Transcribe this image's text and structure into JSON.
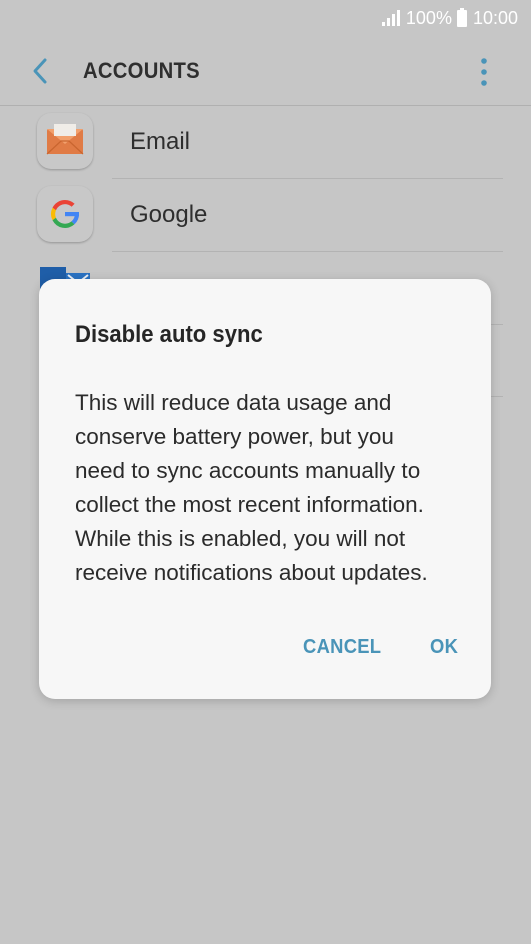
{
  "status_bar": {
    "battery_percent": "100%",
    "time": "10:00"
  },
  "app_bar": {
    "title": "ACCOUNTS",
    "back_icon": "chevron-left-icon",
    "more_icon": "more-vert-icon"
  },
  "accounts": [
    {
      "label": "Email",
      "icon": "email-envelope-icon"
    },
    {
      "label": "Google",
      "icon": "google-g-icon"
    }
  ],
  "partial_account": {
    "icon": "exchange-icon"
  },
  "dialog": {
    "title": "Disable auto sync",
    "body_lines": [
      "This will reduce data usage and",
      "conserve battery power, but you",
      "need to sync accounts manually to",
      "collect the most recent information.",
      "While this is enabled, you will not",
      "receive notifications about updates."
    ],
    "cancel_label": "CANCEL",
    "ok_label": "OK"
  },
  "colors": {
    "accent": "#4a94b8",
    "scrim_background": "#c6c6c6",
    "dialog_background": "#f7f7f7"
  }
}
